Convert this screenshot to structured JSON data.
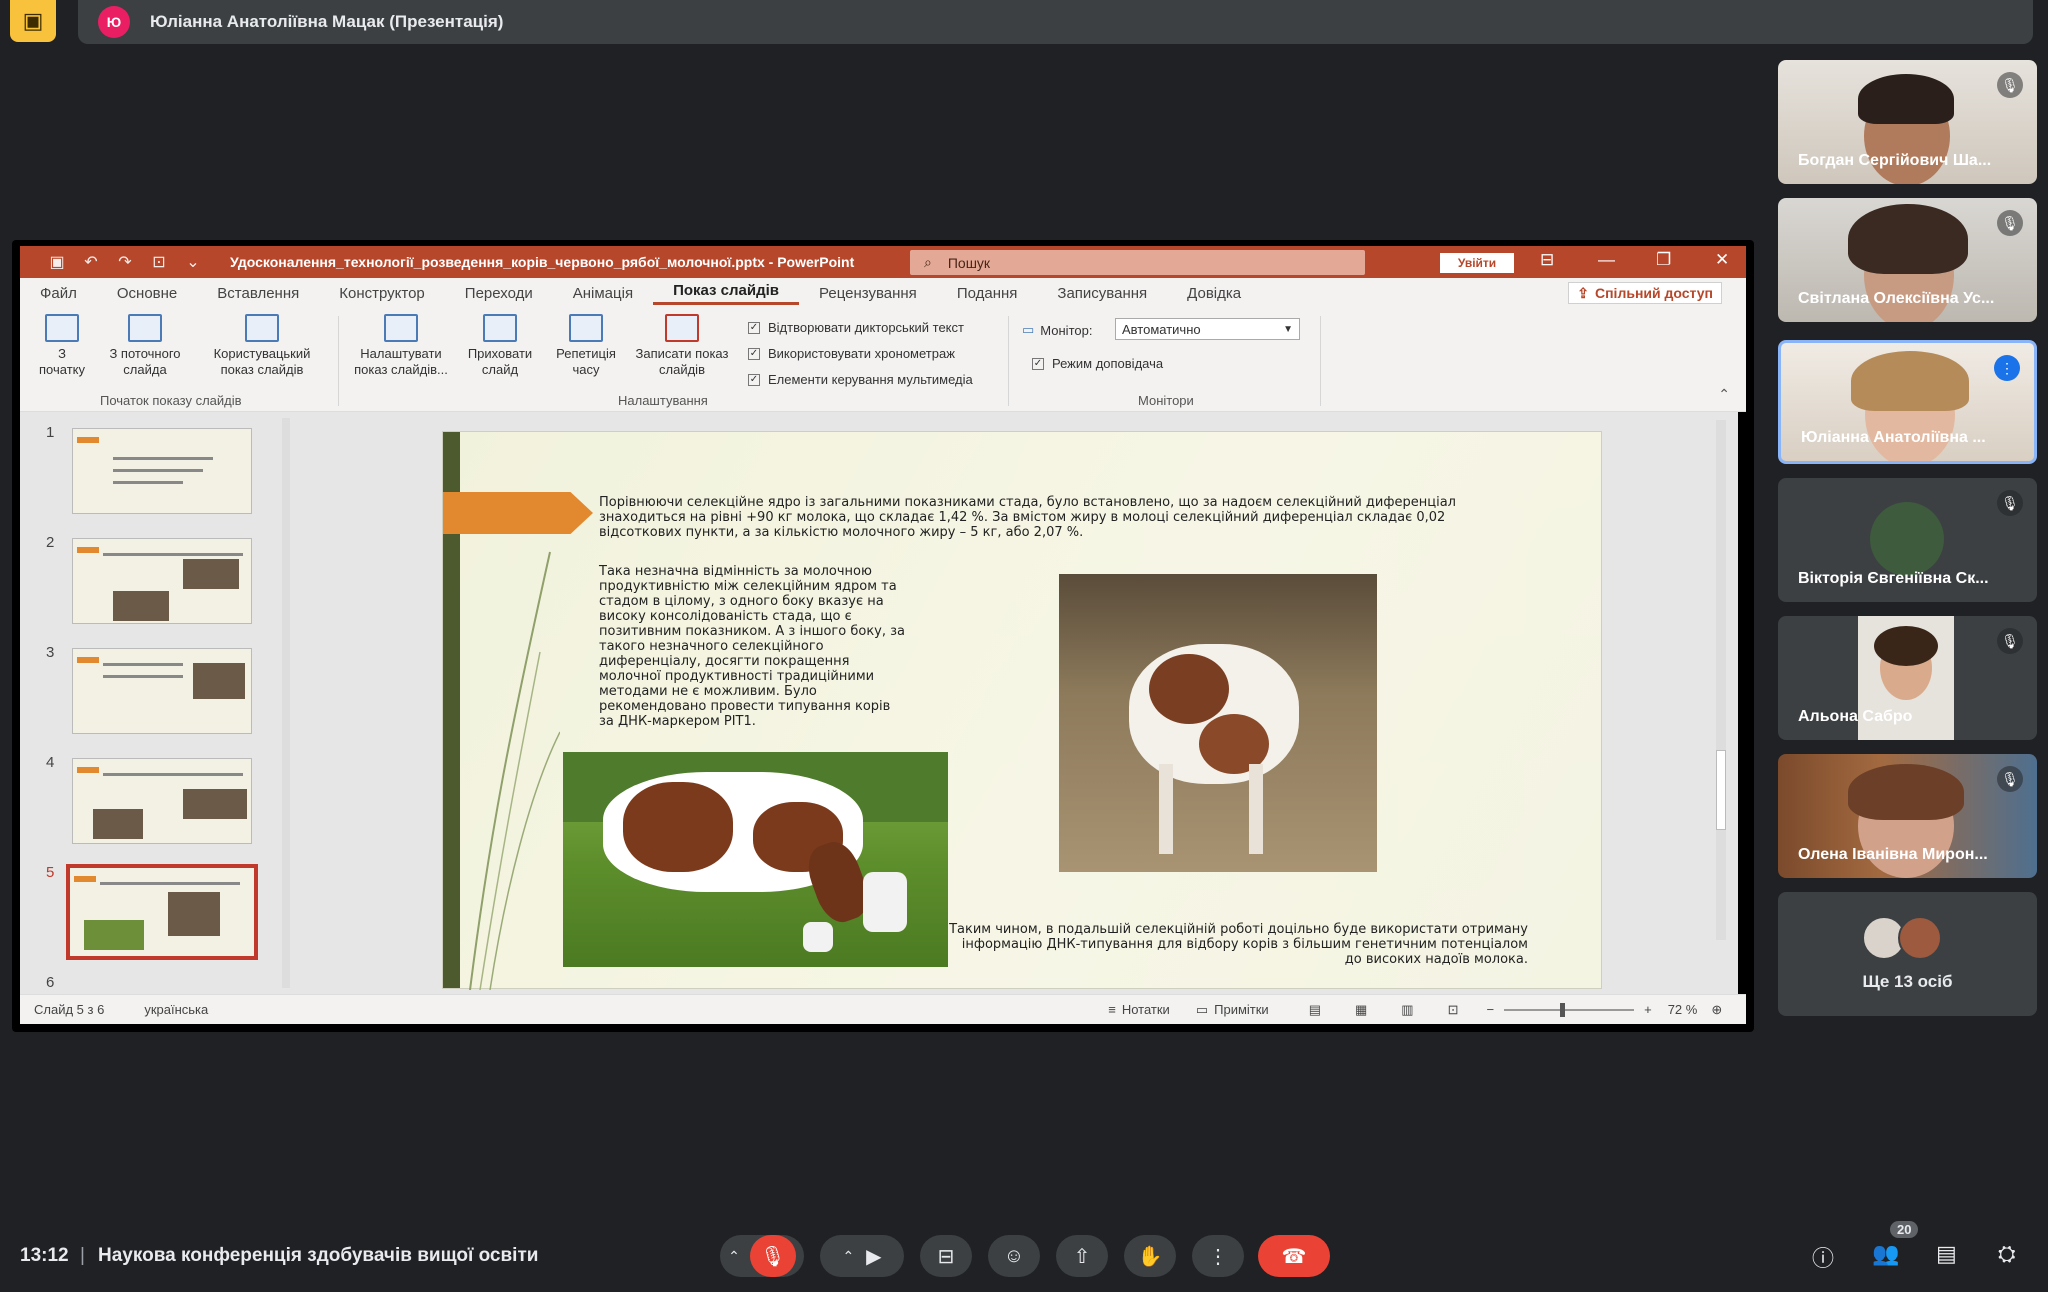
{
  "presenter_bar": {
    "avatar_letter": "Ю",
    "title": "Юліанна Анатоліївна Мацак (Презентація)"
  },
  "powerpoint": {
    "file_title": "Удосконалення_технології_розведення_корів_червоно_рябої_молочної.pptx - PowerPoint",
    "search_placeholder": "Пошук",
    "login_label": "Увійти",
    "menu_tabs": [
      "Файл",
      "Основне",
      "Вставлення",
      "Конструктор",
      "Переходи",
      "Анімація",
      "Показ слайдів",
      "Рецензування",
      "Подання",
      "Записування",
      "Довідка"
    ],
    "active_tab": "Показ слайдів",
    "share_label": "Спільний доступ",
    "ribbon": {
      "btn_from_start": "З\nпочатку",
      "btn_from_current": "З поточного\nслайда",
      "btn_custom": "Користувацький\nпоказ слайдів",
      "group_start": "Початок показу слайдів",
      "btn_setup": "Налаштувати\nпоказ слайдів...",
      "btn_hide": "Приховати\nслайд",
      "btn_rehearse": "Репетиція\nчасу",
      "btn_record": "Записати показ\nслайдів",
      "chk_narration": "Відтворювати дикторський текст",
      "chk_timings": "Використовувати хронометраж",
      "chk_media": "Елементи керування мультимедіа",
      "group_setup": "Налаштування",
      "monitor_label": "Монітор:",
      "monitor_value": "Автоматично",
      "chk_presenter": "Режим доповідача",
      "group_monitors": "Монітори"
    },
    "thumbnails": [
      "1",
      "2",
      "3",
      "4",
      "5",
      "6"
    ],
    "selected_slide": 5,
    "slide": {
      "para1": "Порівнюючи селекційне ядро із загальними показниками стада, було встановлено, що за надоєм селекційний диференціал знаходиться на рівні +90 кг молока, що складає 1,42 %. За вмістом жиру в молоці селекційний диференціал складає 0,02 відсоткових пункти, а за кількістю молочного жиру – 5 кг, або 2,07 %.",
      "para2": "Така незначна відмінність за молочною продуктивністю між селекційним ядром та стадом в цілому, з одного боку вказує на високу консолідованість стада, що є позитивним показником. А з іншого боку, за такого незначного селекційного диференціалу, досягти покращення молочної продуктивності традиційними методами не є можливим. Було рекомендовано провести типування корів за ДНК-маркером PIT1.",
      "para3": "Таким чином, в подальшій селекційній роботі доцільно буде використати отриману інформацію ДНК-типування для відбору корів з більшим генетичним потенціалом до високих надоїв молока."
    },
    "status": {
      "slide_of": "Слайд 5 з 6",
      "language": "українська",
      "notes": "Нотатки",
      "comments": "Примітки",
      "zoom": "72 %"
    }
  },
  "participants": [
    {
      "name": "Богдан Сергійович Ша...",
      "muted": true
    },
    {
      "name": "Світлана Олексіївна Ус...",
      "muted": true
    },
    {
      "name": "Юліанна Анатоліївна ...",
      "speaking": true
    },
    {
      "name": "Вікторія Євгеніївна Ск...",
      "muted": true
    },
    {
      "name": "Альона Сабро",
      "muted": true
    },
    {
      "name": "Олена Іванівна Мирон...",
      "muted": true
    }
  ],
  "more_participants": "Ще 13 осіб",
  "bottom": {
    "time": "13:12",
    "separator": "|",
    "meeting_title": "Наукова конференція здобувачів вищої освіти",
    "people_count": "20"
  },
  "colors": {
    "meet_bg": "#202124",
    "ppt_accent": "#b7472a",
    "end_call": "#ea4335",
    "slide_orange": "#e2892f"
  }
}
